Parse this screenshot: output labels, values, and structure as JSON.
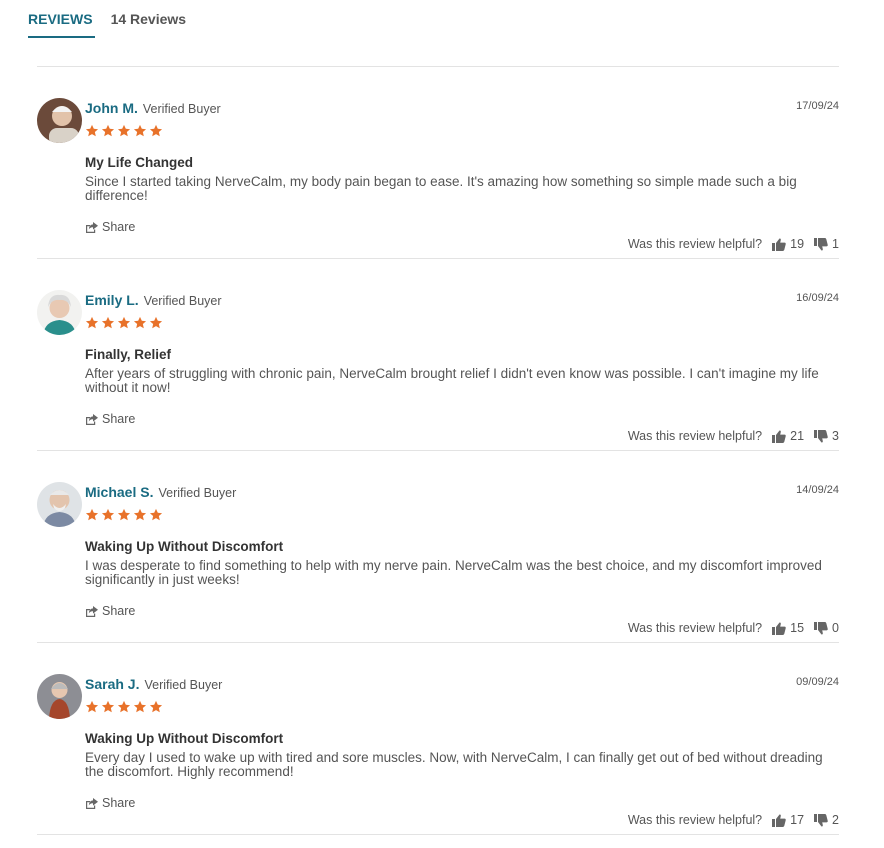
{
  "tabs": {
    "active": "REVIEWS",
    "count": "14 Reviews"
  },
  "colors": {
    "accent": "#1a6b82",
    "star": "#e8722a"
  },
  "helpful_label": "Was this review helpful?",
  "share_label": "Share",
  "reviews": [
    {
      "name": "John M.",
      "verified": "Verified Buyer",
      "date": "17/09/24",
      "rating": 5,
      "title": "My Life Changed",
      "body": "Since I started taking NerveCalm, my body pain began to ease. It's amazing how something so simple made such a big difference!",
      "up": "19",
      "down": "1"
    },
    {
      "name": "Emily L.",
      "verified": "Verified Buyer",
      "date": "16/09/24",
      "rating": 5,
      "title": "Finally, Relief",
      "body": "After years of struggling with chronic pain, NerveCalm brought relief I didn't even know was possible. I can't imagine my life without it now!",
      "up": "21",
      "down": "3"
    },
    {
      "name": "Michael S.",
      "verified": "Verified Buyer",
      "date": "14/09/24",
      "rating": 5,
      "title": "Waking Up Without Discomfort",
      "body": "I was desperate to find something to help with my nerve pain. NerveCalm was the best choice, and my discomfort improved significantly in just weeks!",
      "up": "15",
      "down": "0"
    },
    {
      "name": "Sarah J.",
      "verified": "Verified Buyer",
      "date": "09/09/24",
      "rating": 5,
      "title": "Waking Up Without Discomfort",
      "body": "Every day I used to wake up with tired and sore muscles. Now, with NerveCalm, I can finally get out of bed without dreading the discomfort. Highly recommend!",
      "up": "17",
      "down": "2"
    }
  ]
}
